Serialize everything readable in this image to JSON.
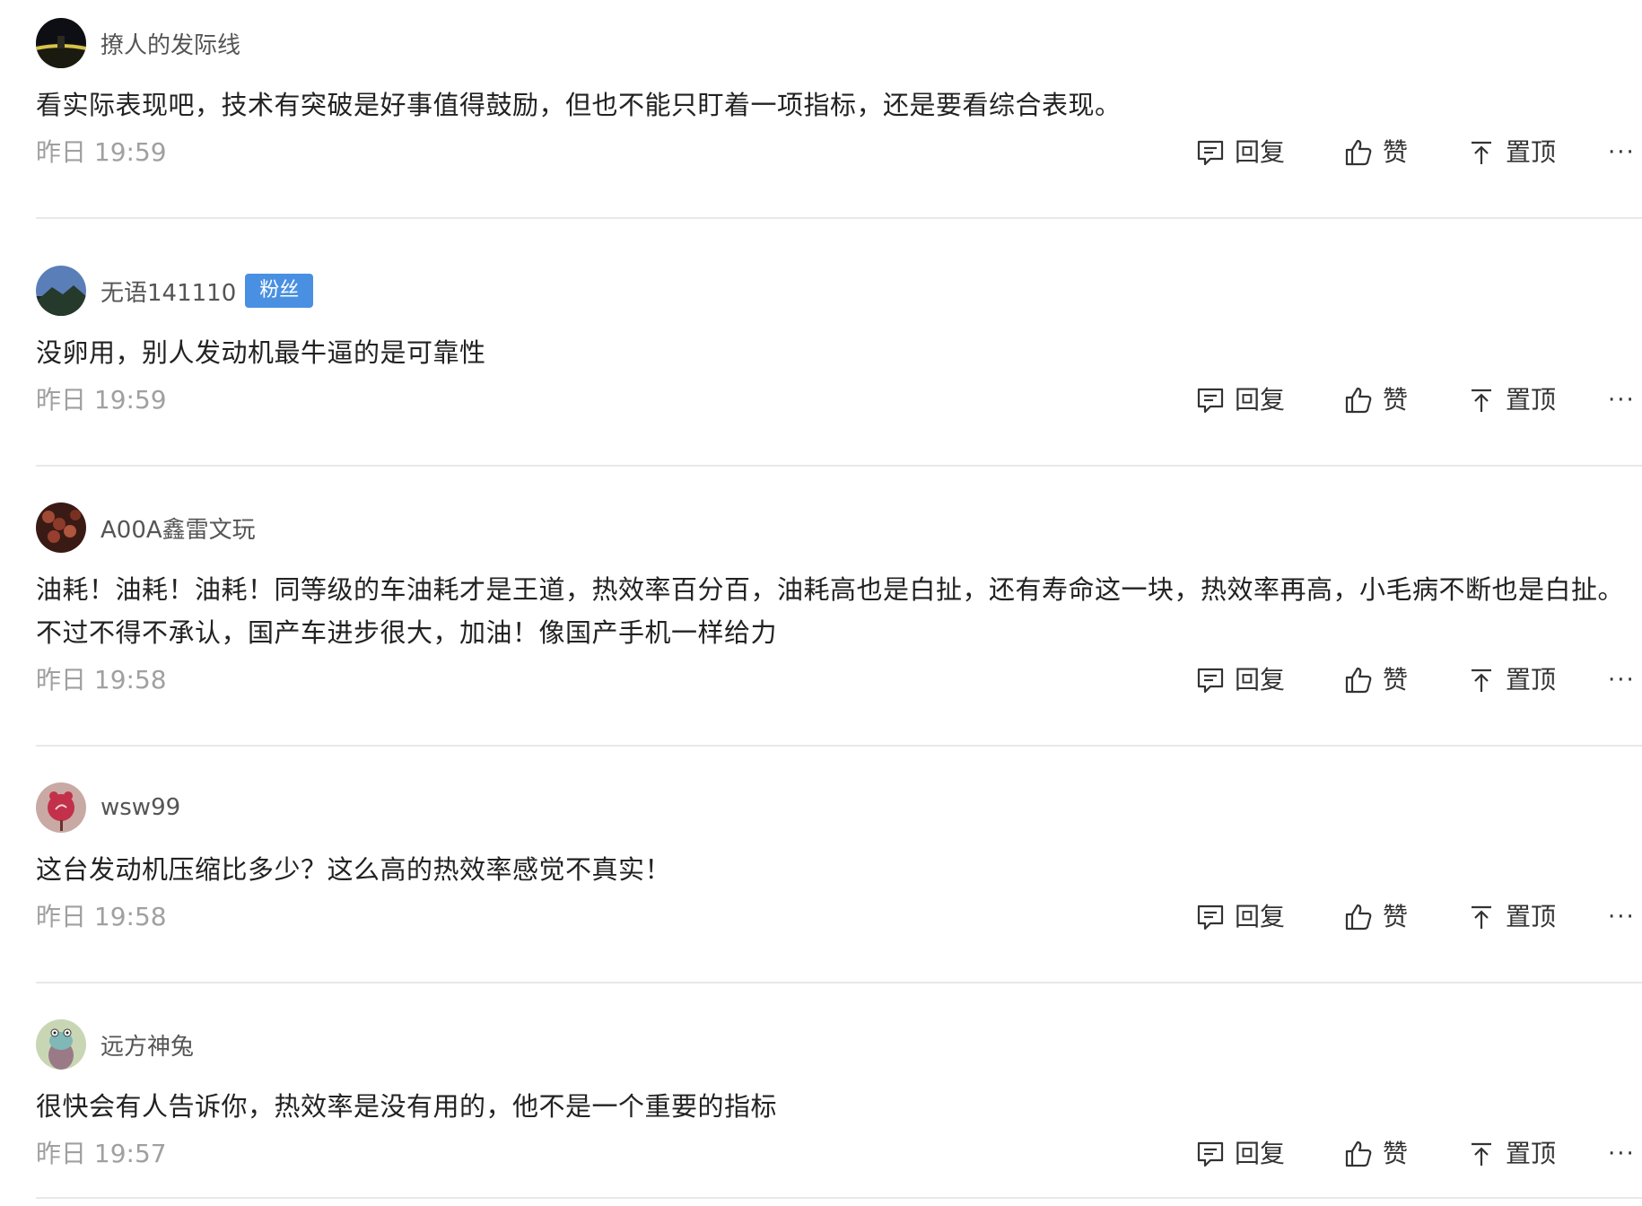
{
  "actions": {
    "reply_label": "回复",
    "like_label": "赞",
    "pin_label": "置顶",
    "more_label": "···"
  },
  "comments": [
    {
      "username": "撩人的发际线",
      "badge": "",
      "content": "看实际表现吧，技术有突破是好事值得鼓励，但也不能只盯着一项指标，还是要看综合表现。",
      "timestamp": "昨日 19:59",
      "avatar_icon": "night-road-avatar"
    },
    {
      "username": "无语141110",
      "badge": "粉丝",
      "content": "没卵用，别人发动机最牛逼的是可靠性",
      "timestamp": "昨日 19:59",
      "avatar_icon": "mountain-avatar"
    },
    {
      "username": "A00A鑫雷文玩",
      "badge": "",
      "content": "油耗！油耗！油耗！同等级的车油耗才是王道，热效率百分百，油耗高也是白扯，还有寿命这一块，热效率再高，小毛病不断也是白扯。不过不得不承认，国产车进步很大，加油！像国产手机一样给力",
      "timestamp": "昨日 19:58",
      "avatar_icon": "beads-avatar"
    },
    {
      "username": "wsw99",
      "badge": "",
      "content": "这台发动机压缩比多少？这么高的热效率感觉不真实！",
      "timestamp": "昨日 19:58",
      "avatar_icon": "cartoon-flower-avatar"
    },
    {
      "username": "远方神兔",
      "badge": "",
      "content": "很快会有人告诉你，热效率是没有用的，他不是一个重要的指标",
      "timestamp": "昨日 19:57",
      "avatar_icon": "cartoon-frog-avatar"
    }
  ]
}
